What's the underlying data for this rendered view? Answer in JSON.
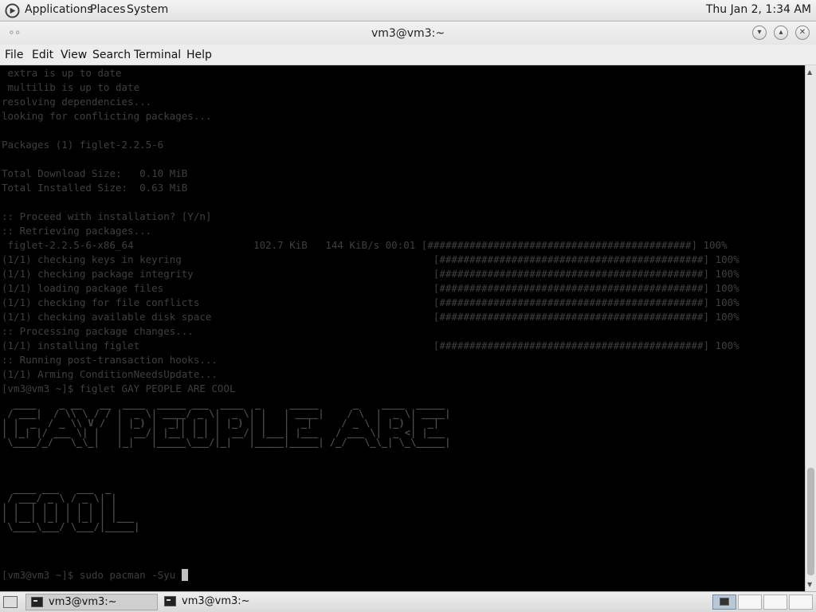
{
  "top_panel": {
    "menus": [
      "Applications",
      "Places",
      "System"
    ],
    "clock": "Thu Jan  2,  1:34 AM"
  },
  "window": {
    "title": "vm3@vm3:~",
    "menubar": [
      "File",
      "Edit",
      "View",
      "Search",
      "Terminal",
      "Help"
    ]
  },
  "terminal": {
    "output": " extra is up to date\n multilib is up to date\nresolving dependencies...\nlooking for conflicting packages...\n\nPackages (1) figlet-2.2.5-6\n\nTotal Download Size:   0.10 MiB\nTotal Installed Size:  0.63 MiB\n\n:: Proceed with installation? [Y/n]\n:: Retrieving packages...\n figlet-2.2.5-6-x86_64                    102.7 KiB   144 KiB/s 00:01 [############################################] 100%\n(1/1) checking keys in keyring                                          [############################################] 100%\n(1/1) checking package integrity                                        [############################################] 100%\n(1/1) loading package files                                             [############################################] 100%\n(1/1) checking for file conflicts                                       [############################################] 100%\n(1/1) checking available disk space                                     [############################################] 100%\n:: Processing package changes...\n(1/1) installing figlet                                                 [############################################] 100%\n:: Running post-transaction hooks...\n(1/1) Arming ConditionNeedsUpdate...\n[vm3@vm3 ~]$ figlet GAY PEOPLE ARE COOL",
    "banner_line1": "  ____    _ __   __  ____  _____ ___  ____  _     _____      _    ____  _____\n / ___|  / \\\\ \\ / / |  _ \\| ____/ _ \\|  _ \\| |   | ____|    / \\  |  _ \\| ____|\n| |  _  / _ \\\\ V /  | |_) |  _|| | | | |_) | |   |  _|     / _ \\ | |_) |  _|\n| |_| |/ ___ \\| |   |  __/| |__| |_| |  __/| |___| |___   / ___ \\|  _ <| |___\n \\____/_/   \\_\\_|   |_|   |_____\\___/|_|   |_____|_____| /_/   \\_\\_| \\_\\_____|",
    "banner_line2": "  ____ ___   ___  _\n / ___/ _ \\ / _ \\| |\n| |  | | | | | | | |\n| |__| |_| | |_| | |___\n \\____\\___/ \\___/|_____|",
    "prompt": "[vm3@vm3 ~]$ sudo pacman -Syu "
  },
  "taskbar": {
    "tasks": [
      "vm3@vm3:~",
      "vm3@vm3:~"
    ]
  }
}
